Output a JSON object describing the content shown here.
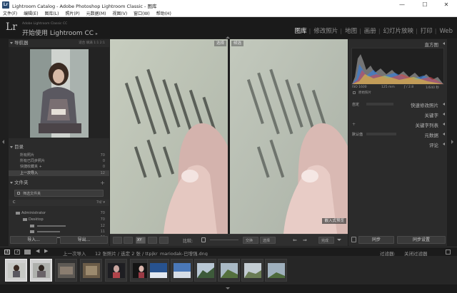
{
  "window": {
    "title": "Lightroom Catalog - Adobe Photoshop Lightroom Classic - 图库",
    "app_icon": "Lr",
    "controls": [
      "—",
      "☐",
      "✕"
    ]
  },
  "menu": [
    "文件(F)",
    "编辑(E)",
    "图库(L)",
    "照片(P)",
    "元数据(M)",
    "视图(V)",
    "窗口(W)",
    "帮助(H)"
  ],
  "identity": {
    "logo": "Lr",
    "sub": "Adobe Lightroom Classic CC",
    "name": "开始使用 Lightroom CC",
    "name_arrow": "▸",
    "modules": [
      "图库",
      "修改照片",
      "地图",
      "画册",
      "幻灯片放映",
      "打印",
      "Web"
    ],
    "active_module": "图库"
  },
  "left_panel": {
    "navigator": {
      "title": "导航器",
      "options": "适合   填满   1:1   2:1"
    },
    "catalog": {
      "title": "目录",
      "items": [
        {
          "label": "所有照片",
          "count": "70"
        },
        {
          "label": "所有已同步照片",
          "count": "0"
        },
        {
          "label": "快捷收藏夹 +",
          "count": "0"
        },
        {
          "label": "上一次导入",
          "count": "12"
        }
      ],
      "selected_index": 3
    },
    "folders": {
      "title": "文件夹",
      "plus": "+",
      "filter_placeholder": "筛选文件夹",
      "volume": "C",
      "volume_info": "7d/ ▾",
      "tree": [
        {
          "label": "Administrator",
          "count": "70"
        },
        {
          "label": "Desktop",
          "count": "70"
        },
        {
          "label": "",
          "count": "12"
        },
        {
          "label": "",
          "count": "11"
        },
        {
          "label": "",
          "count": "24"
        }
      ]
    },
    "import_button": "导入...",
    "export_button": "导出..."
  },
  "center": {
    "select_label": "选择",
    "candidate_label": "候选",
    "embedded_preview": "嵌入式预览"
  },
  "toolbar": {
    "compare_label": "比较:",
    "swap_label": "交换",
    "make_label": "选择",
    "done_label": "完成"
  },
  "right_panel": {
    "histogram": {
      "title": "直方图",
      "iso": "ISO 1600",
      "focal": "125 mm",
      "aperture": "ƒ / 2.8",
      "shutter": "1/640 秒",
      "original_label": "原始照片"
    },
    "quick_develop": {
      "preset": "自定",
      "title": "快速修改照片"
    },
    "keywording": {
      "title": "关键字"
    },
    "keyword_list": {
      "title": "关键字列表"
    },
    "metadata": {
      "preset": "默认值",
      "title": "元数据"
    },
    "comments": {
      "title": "评论"
    },
    "sync_button": "同步",
    "sync_settings_button": "同步设置"
  },
  "filmstrip_header": {
    "pages": [
      "1",
      "2"
    ],
    "source": "上一次导入",
    "info": "12 张照片 / 选定 2 张 / ttpjkr_mariodak-已增强.dng",
    "filter_label": "过滤器:",
    "filter_value": "关闭过滤器"
  },
  "colors": {
    "background": "#1f1f1f",
    "panel": "#2b2b2b",
    "active_text": "#e8e8e8"
  }
}
